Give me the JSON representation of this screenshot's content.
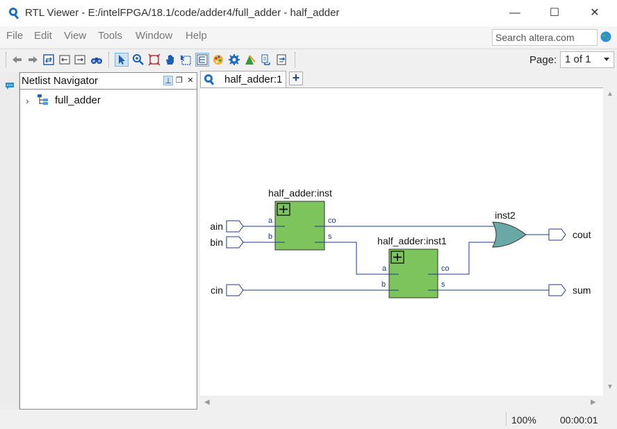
{
  "window": {
    "title": "RTL Viewer - E:/intelFPGA/18.1/code/adder4/full_adder - half_adder",
    "minimize_icon": "minimize-icon",
    "maximize_icon": "maximize-icon",
    "close_icon": "close-icon"
  },
  "menubar": {
    "items": [
      "File",
      "Edit",
      "View",
      "Tools",
      "Window",
      "Help"
    ],
    "search_placeholder": "Search altera.com"
  },
  "toolbar": {
    "icons": [
      "back-icon",
      "forward-icon",
      "refresh-icon",
      "go-to-prev-icon",
      "go-to-next-icon",
      "find-icon",
      "selection-tool-icon",
      "zoom-tool-icon",
      "fit-window-icon",
      "hand-tool-icon",
      "area-select-icon",
      "hierarchy-icon",
      "color-icon",
      "settings-icon",
      "highlight-icon",
      "netlist-icon",
      "export-icon"
    ],
    "page_label": "Page:",
    "page_value": "1 of 1"
  },
  "navigator": {
    "title": "Netlist Navigator",
    "tree": [
      {
        "label": "full_adder"
      }
    ]
  },
  "tabs": [
    {
      "label": "half_adder:1"
    }
  ],
  "schematic": {
    "inputs": [
      "ain",
      "bin",
      "cin"
    ],
    "outputs": [
      "cout",
      "sum"
    ],
    "instances": [
      {
        "name": "half_adder:inst",
        "ports_in": [
          "a",
          "b"
        ],
        "ports_out": [
          "co",
          "s"
        ]
      },
      {
        "name": "half_adder:inst1",
        "ports_in": [
          "a",
          "b"
        ],
        "ports_out": [
          "co",
          "s"
        ]
      }
    ],
    "gate": {
      "name": "inst2",
      "type": "OR"
    },
    "colors": {
      "block_fill": "#7dc45d",
      "gate_fill": "#6aa7a7",
      "wire": "#1a3a8a"
    }
  },
  "status": {
    "zoom": "100%",
    "elapsed": "00:00:01"
  }
}
